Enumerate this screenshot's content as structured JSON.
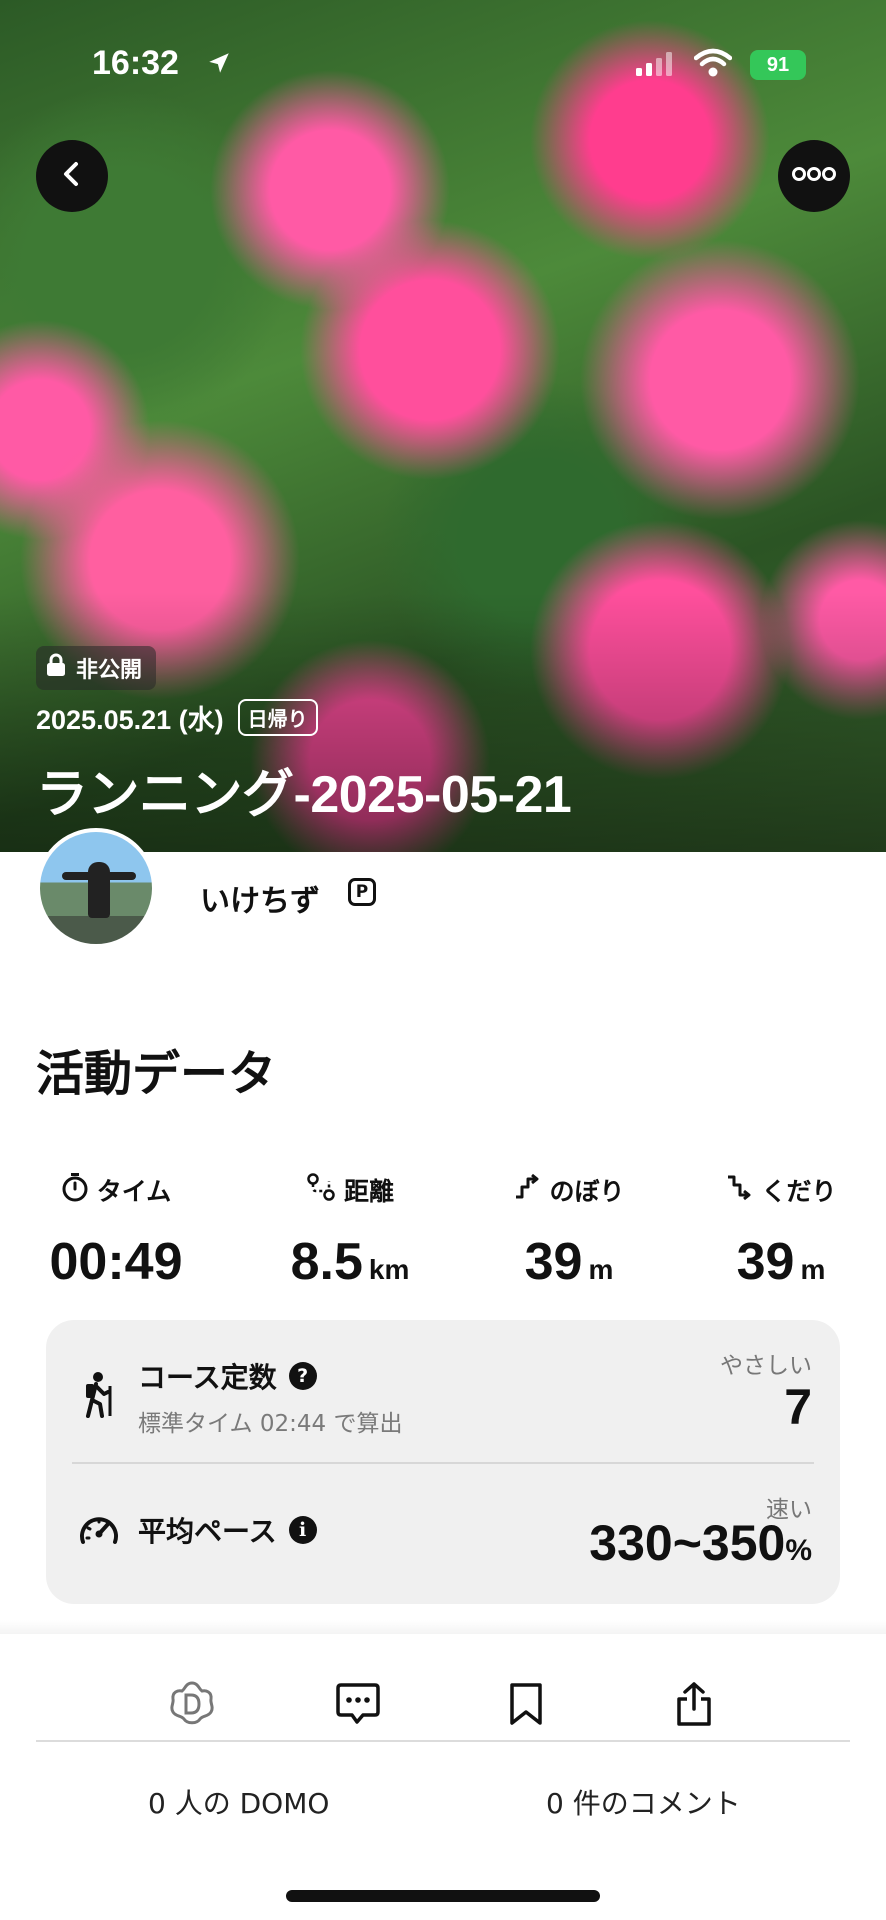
{
  "status_bar": {
    "time": "16:32",
    "battery": "91"
  },
  "hero": {
    "privacy": "非公開",
    "date": "2025.05.21 (水)",
    "trip_type": "日帰り",
    "title": "ランニング-2025-05-21"
  },
  "profile": {
    "username": "いけちず",
    "badge": "P"
  },
  "activity": {
    "section_title": "活動データ",
    "stats": [
      {
        "label": "タイム",
        "value": "00:49",
        "unit": ""
      },
      {
        "label": "距離",
        "value": "8.5",
        "unit": "km"
      },
      {
        "label": "のぼり",
        "value": "39",
        "unit": "m"
      },
      {
        "label": "くだり",
        "value": "39",
        "unit": "m"
      }
    ],
    "course_constant": {
      "title": "コース定数",
      "subtitle": "標準タイム 02:44 で算出",
      "difficulty": "やさしい",
      "value": "7"
    },
    "average_pace": {
      "title": "平均ペース",
      "speed_label": "速い",
      "value": "330~350",
      "unit": "%"
    }
  },
  "bottom": {
    "domo_label": "0 人の DOMO",
    "comments_label": "0 件のコメント"
  }
}
